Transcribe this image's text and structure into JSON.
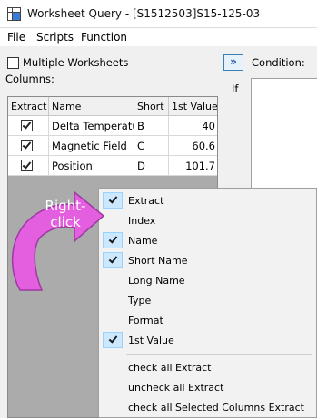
{
  "window": {
    "title": "Worksheet Query - [S1512503]S15-125-03"
  },
  "menubar": {
    "items": [
      "File",
      "Scripts",
      "Function"
    ]
  },
  "options": {
    "multiple_worksheets_label": "Multiple Worksheets",
    "multiple_worksheets_checked": false,
    "columns_label": "Columns:"
  },
  "grid": {
    "headers": [
      "Extract",
      "Name",
      "Short",
      "1st Value"
    ],
    "rows": [
      {
        "extract": true,
        "name": "Delta Temperatur",
        "short": "B",
        "first_value": "40"
      },
      {
        "extract": true,
        "name": "Magnetic Field",
        "short": "C",
        "first_value": "60.6"
      },
      {
        "extract": true,
        "name": "Position",
        "short": "D",
        "first_value": "101.7"
      }
    ]
  },
  "right_panel": {
    "toggle_label": "»",
    "condition_label": "Condition:",
    "if_label": "If"
  },
  "annotation": {
    "line1": "Right-",
    "line2": "click",
    "color": "#e45ee0"
  },
  "context_menu": {
    "items": [
      {
        "label": "Extract",
        "checked": true
      },
      {
        "label": "Index",
        "checked": false
      },
      {
        "label": "Name",
        "checked": true
      },
      {
        "label": "Short Name",
        "checked": true
      },
      {
        "label": "Long Name",
        "checked": false
      },
      {
        "label": "Type",
        "checked": false
      },
      {
        "label": "Format",
        "checked": false
      },
      {
        "label": "1st Value",
        "checked": true
      }
    ],
    "actions": [
      "check all Extract",
      "uncheck all Extract",
      "check all Selected Columns Extract"
    ]
  }
}
